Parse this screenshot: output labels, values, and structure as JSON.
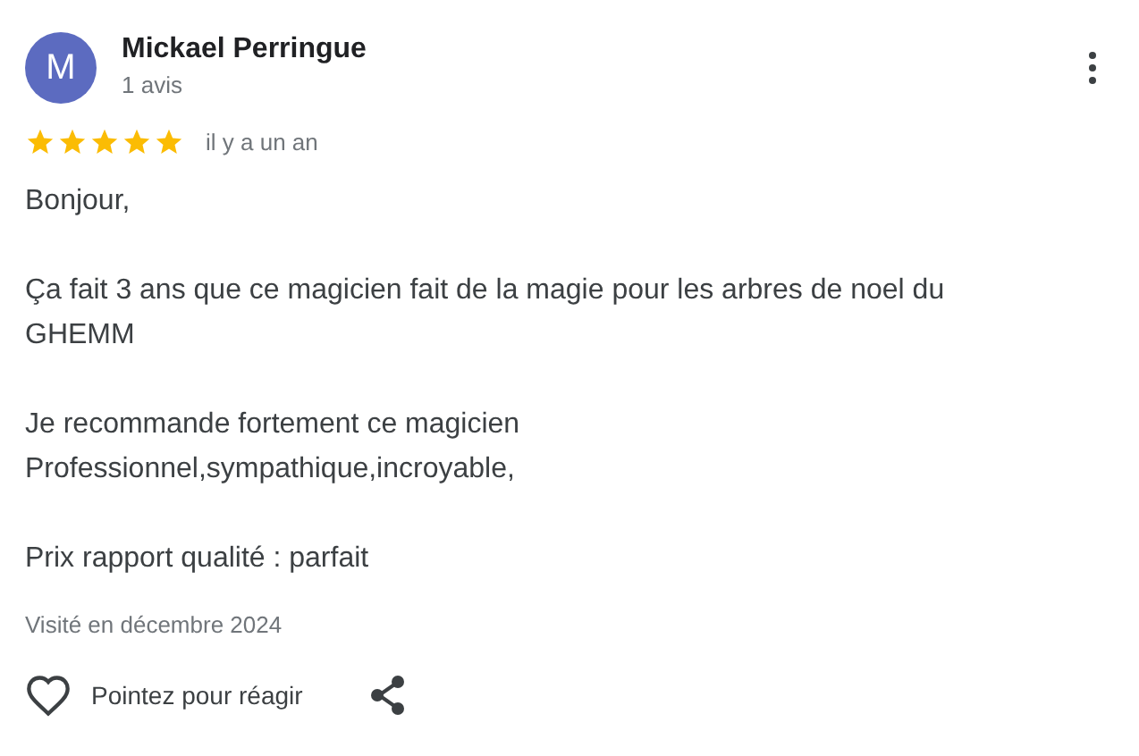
{
  "review": {
    "avatar_letter": "M",
    "author": "Mickael Perringue",
    "author_reviews": "1 avis",
    "stars": 5,
    "time": "il y a un an",
    "paragraphs": [
      "Bonjour,",
      "Ça fait 3 ans que ce magicien fait de la magie pour les arbres de noel du GHEMM",
      "Je recommande fortement ce magicien\nProfessionnel,sympathique,incroyable,",
      "Prix rapport qualité : parfait"
    ],
    "visited": "Visité en décembre 2024",
    "react_label": "Pointez pour réagir"
  }
}
